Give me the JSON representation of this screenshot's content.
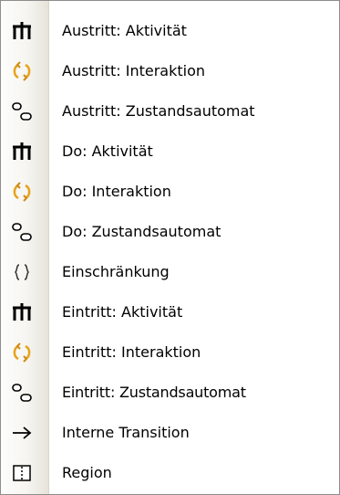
{
  "menu": {
    "items": [
      {
        "label": "Austritt: Aktivität",
        "icon": "activity-icon"
      },
      {
        "label": "Austritt: Interaktion",
        "icon": "interaction-icon"
      },
      {
        "label": "Austritt: Zustandsautomat",
        "icon": "state-machine-icon"
      },
      {
        "label": "Do: Aktivität",
        "icon": "activity-icon"
      },
      {
        "label": "Do: Interaktion",
        "icon": "interaction-icon"
      },
      {
        "label": "Do: Zustandsautomat",
        "icon": "state-machine-icon"
      },
      {
        "label": "Einschränkung",
        "icon": "constraint-icon"
      },
      {
        "label": "Eintritt: Aktivität",
        "icon": "activity-icon"
      },
      {
        "label": "Eintritt: Interaktion",
        "icon": "interaction-icon"
      },
      {
        "label": "Eintritt: Zustandsautomat",
        "icon": "state-machine-icon"
      },
      {
        "label": "Interne Transition",
        "icon": "arrow-right-icon"
      },
      {
        "label": "Region",
        "icon": "region-icon"
      }
    ]
  },
  "colors": {
    "border": "#8d8d8d",
    "interaction_accent": "#e8a21c",
    "gutter": "#f3f1ec"
  }
}
